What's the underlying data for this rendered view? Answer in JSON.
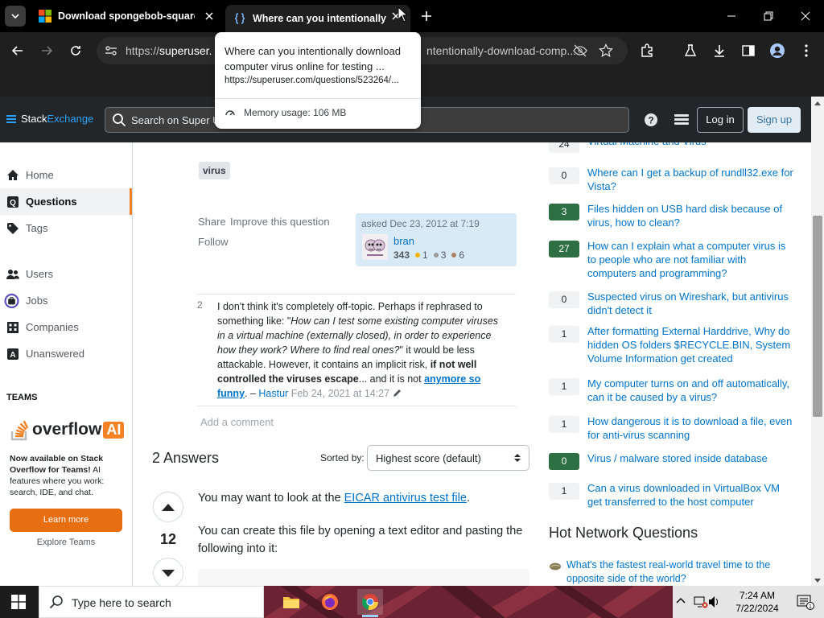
{
  "browser": {
    "tabs": [
      {
        "title": "Download spongebob-squarep"
      },
      {
        "title": "Where can you intentionally do"
      }
    ],
    "address": {
      "url_scheme": "https://",
      "url_domain": "superuser.",
      "url_tail": "ntentionally-download-comp..."
    },
    "hovercard": {
      "title": "Where can you intentionally download computer virus online for testing ...",
      "url": "https://superuser.com/questions/523264/...",
      "memory": "Memory usage: 106 MB"
    }
  },
  "se_header": {
    "logo_stack": "Stack",
    "logo_exchange": "Exchange",
    "search_placeholder": "Search on Super U",
    "login": "Log in",
    "signup": "Sign up"
  },
  "leftnav": {
    "items": [
      {
        "label": "Home"
      },
      {
        "label": "Questions"
      },
      {
        "label": "Tags"
      },
      {
        "label": "Users"
      },
      {
        "label": "Jobs"
      },
      {
        "label": "Companies"
      },
      {
        "label": "Unanswered"
      }
    ],
    "teams_label": "TEAMS",
    "promo_word": "overflow",
    "promo_ai": "AI",
    "promo_bold": "Now available on Stack Overflow for Teams!",
    "promo_text": " AI features where you work: search, IDE, and chat.",
    "learn_more": "Learn more",
    "explore": "Explore Teams"
  },
  "question": {
    "tag": "virus",
    "share": "Share",
    "improve": "Improve this question",
    "follow": "Follow",
    "asked": "asked Dec 23, 2012 at 7:19",
    "user": "bran",
    "rep": "343",
    "gold": "1",
    "silver": "3",
    "bronze": "6",
    "badge_colors": {
      "gold": "#f1b600",
      "silver": "#9a9a9a",
      "bronze": "#ab825f"
    }
  },
  "comment": {
    "score": "2",
    "t1": "I don't think it's completely off-topic. Perhaps if rephrased to something like: \"",
    "quote": "How can I test some existing computer viruses in a virtual machine (externally closed), in order to experience how they work? Where to find real ones?",
    "t2": "\" it would be less attackable. However, it contains an implicit risk, ",
    "bold": "if not well controlled the viruses escape",
    "t3": "... and it is not ",
    "link": "anymore so funny",
    "t4": ". – ",
    "user": "Hastur",
    "time": "Feb 24, 2021 at 14:27",
    "add": "Add a comment"
  },
  "answers": {
    "heading": "2 Answers",
    "sorted_by": "Sorted by:",
    "sort_value": "Highest score (default)",
    "votes": "12",
    "p1_before": "You may want to look at the ",
    "p1_link": "EICAR antivirus test file",
    "p1_after": ".",
    "p2": "You can create this file by opening a text editor and pasting the following into it:"
  },
  "related": [
    {
      "score": "24",
      "title": "Virtual Machine and Virus",
      "answered": false
    },
    {
      "score": "0",
      "title": "Where can I get a backup of rundll32.exe for Vista?",
      "answered": false
    },
    {
      "score": "3",
      "title": "Files hidden on USB hard disk because of virus, how to clean?",
      "answered": true
    },
    {
      "score": "27",
      "title": "How can I explain what a computer virus is to people who are not familiar with computers and programming?",
      "answered": true
    },
    {
      "score": "0",
      "title": "Suspected virus on Wireshark, but antivirus didn't detect it",
      "answered": false
    },
    {
      "score": "1",
      "title": "After formatting External Harddrive, Why do hidden OS folders $RECYCLE.BIN, System Volume Information get created",
      "answered": false
    },
    {
      "score": "1",
      "title": "My computer turns on and off automatically, can it be caused by a virus?",
      "answered": false
    },
    {
      "score": "1",
      "title": "How dangerous it is to download a file, even for anti-virus scanning",
      "answered": false
    },
    {
      "score": "0",
      "title": "Virus / malware stored inside database",
      "answered": true
    },
    {
      "score": "1",
      "title": "Can a virus downloaded in VirtualBox VM get transferred to the host computer",
      "answered": false
    }
  ],
  "hnq": {
    "heading": "Hot Network Questions",
    "items": [
      {
        "title": "What's the fastest real-world travel time to the opposite side of the world?"
      }
    ]
  },
  "taskbar": {
    "search_placeholder": "Type here to search",
    "time": "7:24 AM",
    "date": "7/22/2024",
    "notif_count": "1"
  }
}
